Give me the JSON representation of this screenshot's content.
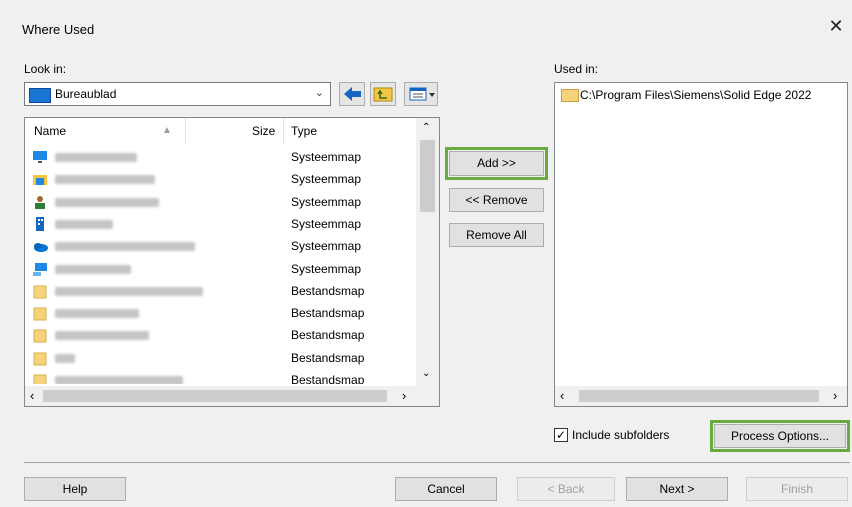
{
  "window": {
    "title": "Where Used",
    "close_glyph": "✕"
  },
  "look_in": {
    "label": "Look in:",
    "value": "Bureaublad",
    "icon": "desktop-icon"
  },
  "file_list": {
    "columns": {
      "name": "Name",
      "size": "Size",
      "type": "Type"
    },
    "rows": [
      {
        "icon": "monitor-icon",
        "type": "Systeemmap",
        "blur_w": 82
      },
      {
        "icon": "user-folder-icon",
        "type": "Systeemmap",
        "blur_w": 100
      },
      {
        "icon": "person-icon",
        "type": "Systeemmap",
        "blur_w": 104
      },
      {
        "icon": "building-icon",
        "type": "Systeemmap",
        "blur_w": 58
      },
      {
        "icon": "onedrive-icon",
        "type": "Systeemmap",
        "blur_w": 140
      },
      {
        "icon": "network-icon",
        "type": "Systeemmap",
        "blur_w": 76
      },
      {
        "icon": "folder-icon",
        "type": "Bestandsmap",
        "blur_w": 148
      },
      {
        "icon": "folder-icon",
        "type": "Bestandsmap",
        "blur_w": 84
      },
      {
        "icon": "folder-icon",
        "type": "Bestandsmap",
        "blur_w": 94
      },
      {
        "icon": "folder-icon",
        "type": "Bestandsmap",
        "blur_w": 20
      },
      {
        "icon": "folder-icon",
        "type": "Bestandsmap",
        "blur_w": 128
      }
    ]
  },
  "middle_buttons": {
    "add": "Add >>",
    "remove": "<< Remove",
    "remove_all": "Remove All"
  },
  "used_in": {
    "label": "Used in:",
    "items": [
      "C:\\Program Files\\Siemens\\Solid Edge 2022"
    ]
  },
  "options": {
    "include_subfolders": "Include subfolders",
    "include_checked": true,
    "process_options": "Process Options..."
  },
  "footer": {
    "help": "Help",
    "cancel": "Cancel",
    "back": "< Back",
    "next": "Next >",
    "finish": "Finish"
  },
  "colors": {
    "highlight": "#6aab3e",
    "folder": "#f6d27a",
    "accent": "#1976d2"
  }
}
